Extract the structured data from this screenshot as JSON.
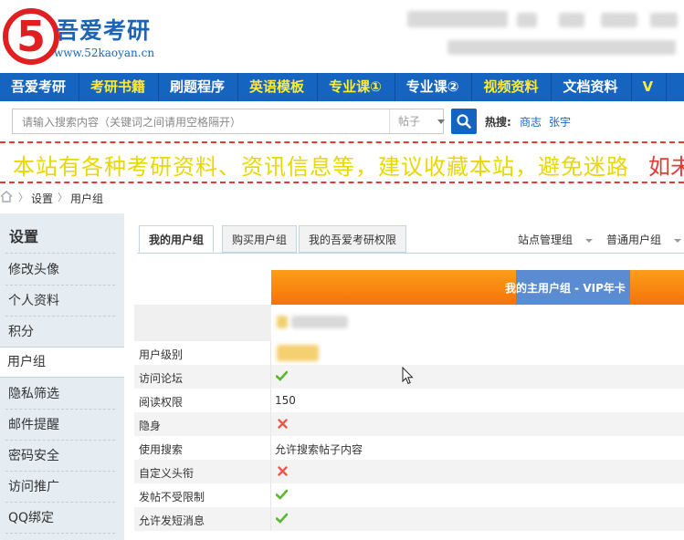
{
  "header": {
    "logo_digit": "5",
    "logo_text": "吾爱考研",
    "logo_url": "www.52kaoyan.cn"
  },
  "nav": {
    "items": [
      {
        "label": "吾爱考研",
        "yellow": false
      },
      {
        "label": "考研书籍",
        "yellow": true
      },
      {
        "label": "刷题程序",
        "yellow": false
      },
      {
        "label": "英语模板",
        "yellow": true
      },
      {
        "label": "专业课①",
        "yellow": true
      },
      {
        "label": "专业课②",
        "yellow": false
      },
      {
        "label": "视频资料",
        "yellow": true
      },
      {
        "label": "文档资料",
        "yellow": false
      },
      {
        "label": "V",
        "yellow": true
      }
    ]
  },
  "search": {
    "placeholder": "请输入搜索内容（关键词之间请用空格隔开）",
    "type_value": "帖子",
    "hot_label": "热搜:",
    "hot_links": [
      "商志",
      "张宇"
    ]
  },
  "announcement": {
    "text": "本站有各种考研资料、资讯信息等，建议收藏本站，避免迷路",
    "text_red": "如未"
  },
  "breadcrumb": [
    "设置",
    "用户组"
  ],
  "sidebar": {
    "title": "设置",
    "items": [
      "修改头像",
      "个人资料",
      "积分",
      "用户组",
      "隐私筛选",
      "邮件提醒",
      "密码安全",
      "访问推广",
      "QQ绑定"
    ]
  },
  "tabs": {
    "items": [
      "我的用户组",
      "购买用户组",
      "我的吾爱考研权限"
    ],
    "right": [
      "站点管理组",
      "普通用户组"
    ]
  },
  "group_banner": "我的主用户组 - VIP年卡",
  "permissions": [
    {
      "label": "用户级别",
      "type": "blur"
    },
    {
      "label": "访问论坛",
      "type": "check"
    },
    {
      "label": "阅读权限",
      "type": "text",
      "value": "150"
    },
    {
      "label": "隐身",
      "type": "cross"
    },
    {
      "label": "使用搜索",
      "type": "text",
      "value": "允许搜索帖子内容"
    },
    {
      "label": "自定义头衔",
      "type": "cross"
    },
    {
      "label": "发帖不受限制",
      "type": "check"
    },
    {
      "label": "允许发短消息",
      "type": "check"
    }
  ],
  "colors": {
    "nav_bg": "#1565c0",
    "accent_blue": "#1565c0",
    "banner_orange": "#f5730a",
    "check_green": "#5cb82e",
    "cross_red": "#e8594b",
    "marquee_yellow": "#e8d800"
  }
}
